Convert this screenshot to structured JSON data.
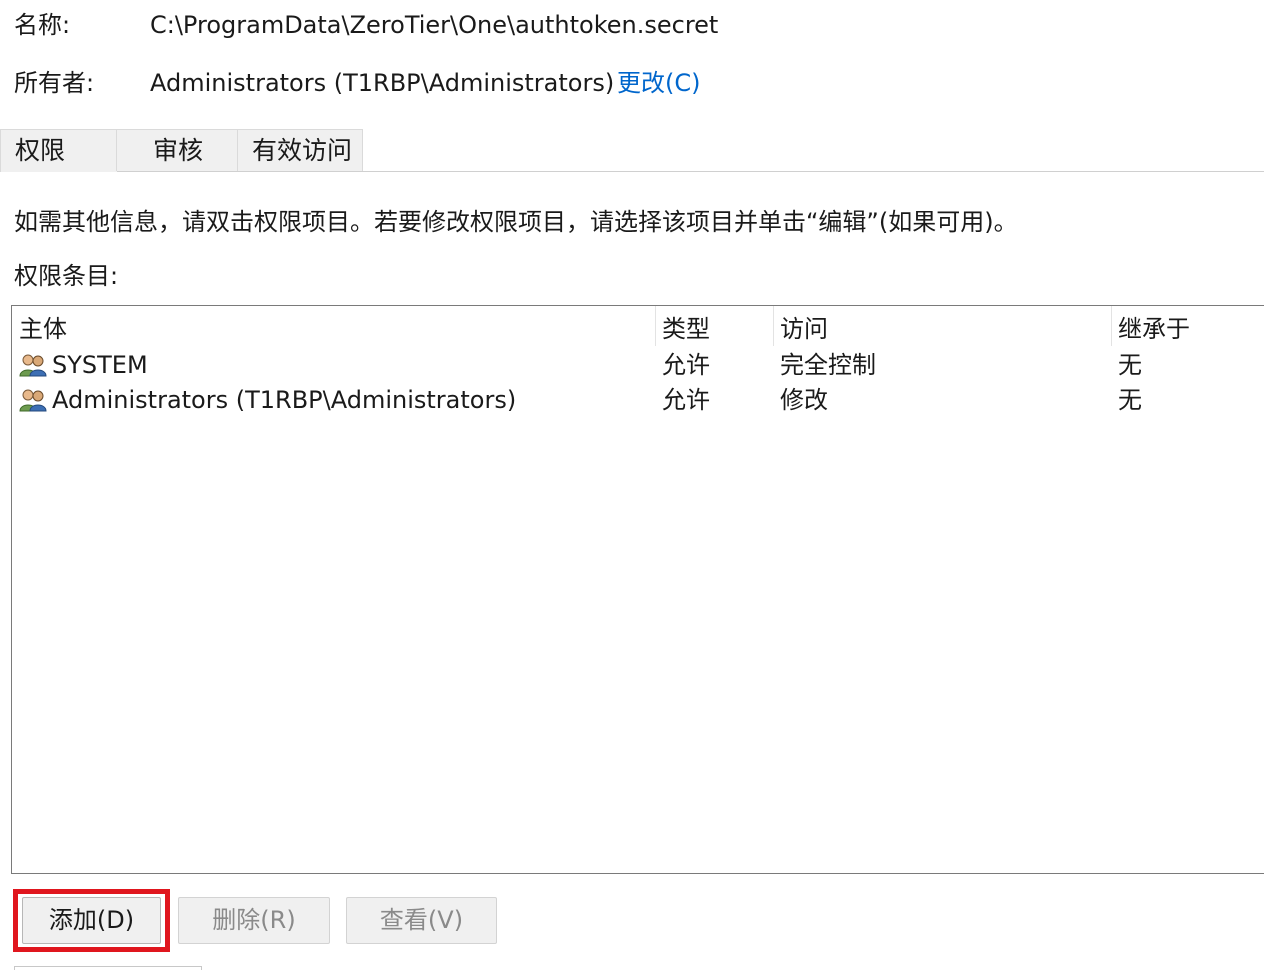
{
  "info": {
    "name_label": "名称:",
    "name_value": "C:\\ProgramData\\ZeroTier\\One\\authtoken.secret",
    "owner_label": "所有者:",
    "owner_value": "Administrators (T1RBP\\Administrators)",
    "change_link": "更改(C)"
  },
  "tabs": [
    {
      "label": "权限",
      "active": true
    },
    {
      "label": "审核",
      "active": false
    },
    {
      "label": "有效访问",
      "active": false
    }
  ],
  "description": "如需其他信息，请双击权限项目。若要修改权限项目，请选择该项目并单击“编辑”(如果可用)。",
  "entries_label": "权限条目:",
  "table": {
    "columns": [
      "主体",
      "类型",
      "访问",
      "继承于"
    ],
    "rows": [
      {
        "principal": "SYSTEM",
        "type": "允许",
        "access": "完全控制",
        "inherited": "无",
        "icon": "user-group-icon"
      },
      {
        "principal": "Administrators (T1RBP\\Administrators)",
        "type": "允许",
        "access": "修改",
        "inherited": "无",
        "icon": "user-group-icon"
      }
    ]
  },
  "buttons": {
    "add": "添加(D)",
    "remove": "删除(R)",
    "view": "查看(V)"
  },
  "colors": {
    "link": "#0066cc",
    "highlight": "#e0161e"
  }
}
